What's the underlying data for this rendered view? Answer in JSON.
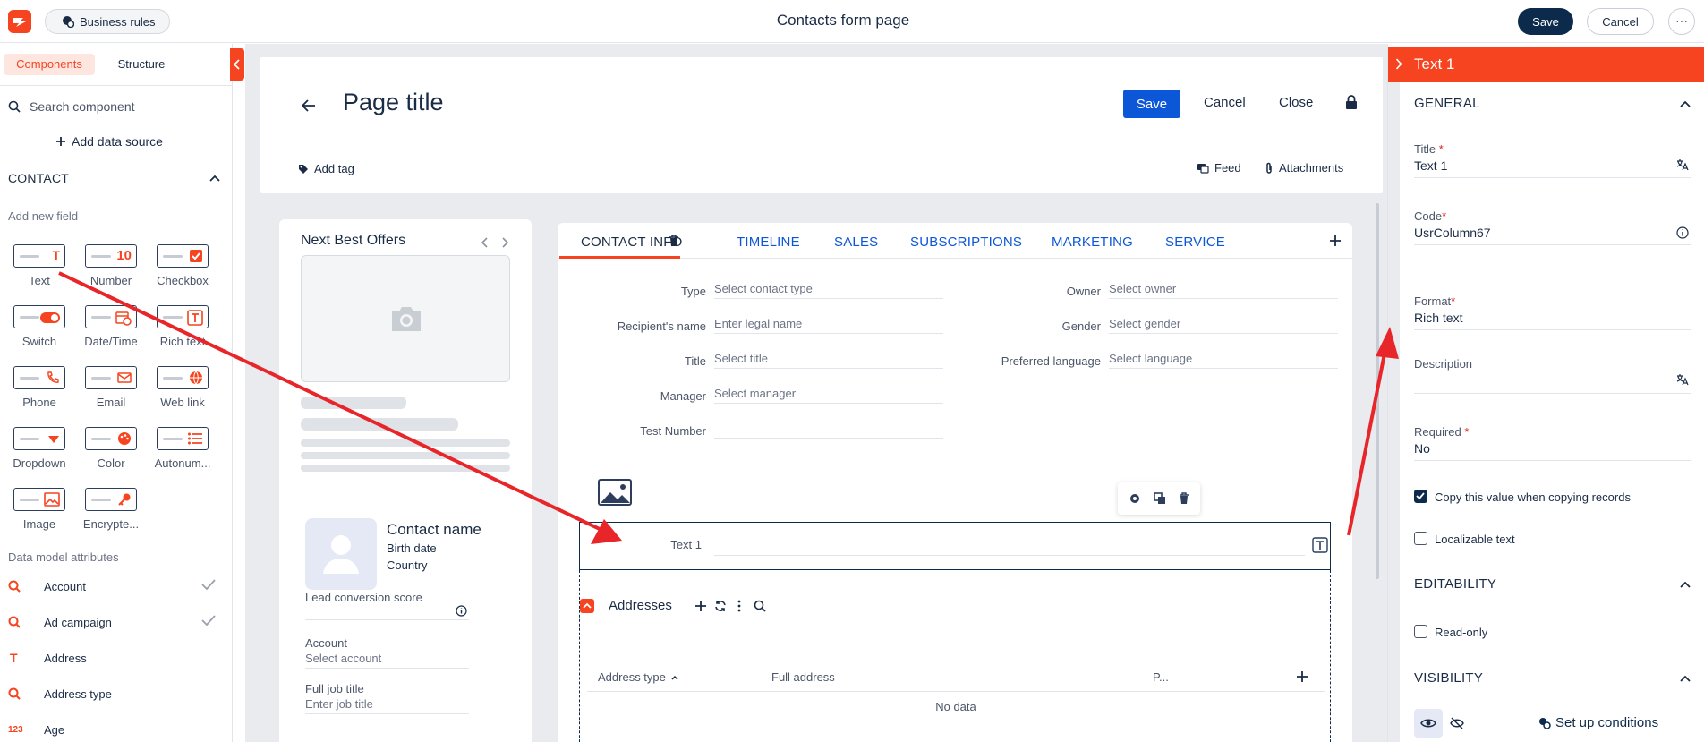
{
  "topbar": {
    "business_rules": "Business rules",
    "title": "Contacts form page",
    "save": "Save",
    "cancel": "Cancel",
    "more": "···"
  },
  "left_panel": {
    "tabs": [
      "Components",
      "Structure"
    ],
    "search_placeholder": "Search component",
    "add_data_source": "Add data source",
    "section": "CONTACT",
    "add_new_field": "Add new field",
    "fields": [
      "Text",
      "Number",
      "Checkbox",
      "Switch",
      "Date/Time",
      "Rich text",
      "Phone",
      "Email",
      "Web link",
      "Dropdown",
      "Color",
      "Autonum...",
      "Image",
      "Encrypte..."
    ],
    "number_glyph": "10",
    "data_model_label": "Data model attributes",
    "attributes": [
      {
        "label": "Account",
        "icon": "lookup-icon",
        "checked": true
      },
      {
        "label": "Ad campaign",
        "icon": "lookup-icon",
        "checked": true
      },
      {
        "label": "Address",
        "icon": "text-icon",
        "checked": false
      },
      {
        "label": "Address type",
        "icon": "lookup-icon",
        "checked": false
      },
      {
        "label": "Age",
        "icon": "number-icon",
        "checked": false
      }
    ],
    "text_glyph": "T",
    "number_attr_glyph": "123"
  },
  "header_card": {
    "page_title": "Page title",
    "save": "Save",
    "cancel": "Cancel",
    "close": "Close",
    "add_tag": "Add tag",
    "feed": "Feed",
    "attachments": "Attachments"
  },
  "nbo": {
    "title": "Next Best Offers"
  },
  "contact_card": {
    "name": "Contact name",
    "birth_date": "Birth date",
    "country": "Country",
    "lead_score_label": "Lead conversion score",
    "account_label": "Account",
    "account_placeholder": "Select account",
    "job_label": "Full job title",
    "job_placeholder": "Enter job title"
  },
  "tabs": [
    "CONTACT INFO",
    "TIMELINE",
    "SALES",
    "SUBSCRIPTIONS",
    "MARKETING",
    "SERVICE"
  ],
  "form_left": [
    {
      "label": "Type",
      "placeholder": "Select contact type"
    },
    {
      "label": "Recipient's name",
      "placeholder": "Enter legal name"
    },
    {
      "label": "Title",
      "placeholder": "Select title"
    },
    {
      "label": "Manager",
      "placeholder": "Select manager"
    },
    {
      "label": "Test Number",
      "placeholder": ""
    }
  ],
  "form_right": [
    {
      "label": "Owner",
      "placeholder": "Select owner"
    },
    {
      "label": "Gender",
      "placeholder": "Select gender"
    },
    {
      "label": "Preferred language",
      "placeholder": "Select language"
    }
  ],
  "selected_field": {
    "label": "Text 1",
    "type_glyph": "T"
  },
  "addresses": {
    "title": "Addresses",
    "col_type": "Address type",
    "col_full": "Full address",
    "col_p": "P...",
    "no_data": "No data"
  },
  "right_panel": {
    "title": "Text 1",
    "general": "GENERAL",
    "title_label": "Title",
    "title_value": "Text 1",
    "code_label": "Code",
    "code_value": "UsrColumn67",
    "format_label": "Format",
    "format_value": "Rich text",
    "description_label": "Description",
    "required_label": "Required",
    "required_value": "No",
    "copy_value": "Copy this value when copying records",
    "localizable": "Localizable text",
    "editability": "EDITABILITY",
    "read_only": "Read-only",
    "visibility": "VISIBILITY",
    "setup_conditions": "Set up conditions",
    "required_mark": "*"
  },
  "colors": {
    "accent": "#f5441f",
    "navy": "#0c2a4b",
    "link": "#0c56d8"
  }
}
